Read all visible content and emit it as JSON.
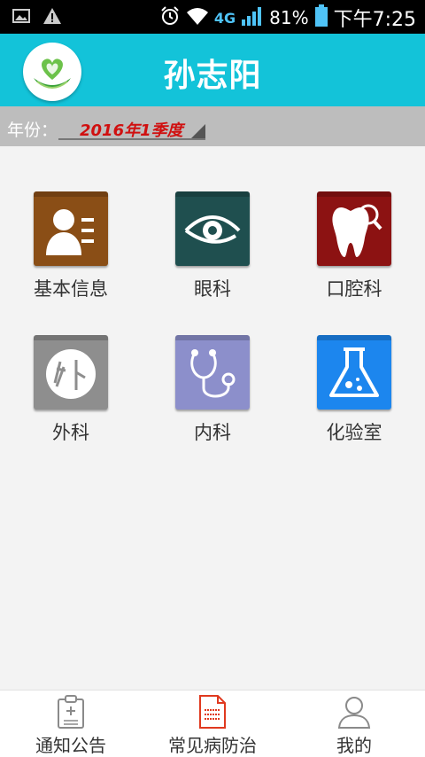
{
  "status_bar": {
    "icons_left": [
      "gallery-icon",
      "warning-icon"
    ],
    "icons_right": [
      "alarm-icon",
      "wifi-icon",
      "signal-icon",
      "battery-icon"
    ],
    "network": "4G",
    "battery": "81%",
    "time": "下午7:25"
  },
  "header": {
    "title": "孙志阳",
    "logo_icon": "heart-hands-logo"
  },
  "year_bar": {
    "label": "年份：",
    "selected": "2016年1季度"
  },
  "grid": {
    "items": [
      {
        "label": "基本信息",
        "icon": "person-card-icon",
        "color": "#8a4e16"
      },
      {
        "label": "眼科",
        "icon": "eye-icon",
        "color": "#1f4f4f"
      },
      {
        "label": "口腔科",
        "icon": "tooth-icon",
        "color": "#8c1212"
      },
      {
        "label": "外科",
        "icon": "surgery-icon",
        "color": "#8e8e8e"
      },
      {
        "label": "内科",
        "icon": "stethoscope-icon",
        "color": "#8c8fcb"
      },
      {
        "label": "化验室",
        "icon": "flask-icon",
        "color": "#1c86ee"
      }
    ]
  },
  "bottom_nav": {
    "items": [
      {
        "label": "通知公告",
        "icon": "clipboard-icon",
        "active": false
      },
      {
        "label": "常见病防治",
        "icon": "document-icon",
        "active": true
      },
      {
        "label": "我的",
        "icon": "user-icon",
        "active": false
      }
    ]
  },
  "colors": {
    "header": "#13c3d9",
    "year_bar": "#bdbdbd",
    "selected_text": "#d01010",
    "active_nav": "#e0391f"
  }
}
